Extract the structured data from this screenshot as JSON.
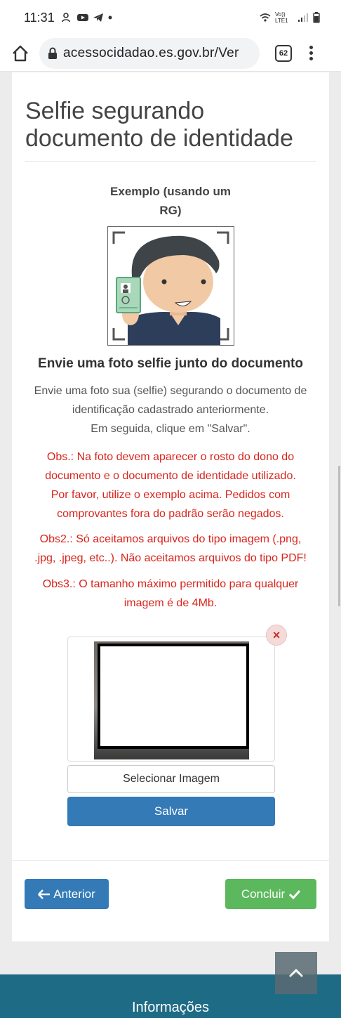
{
  "status_bar": {
    "time": "11:31",
    "network_label": "Vo)) LTE1"
  },
  "browser": {
    "url": "acessocidadao.es.gov.br/Ver",
    "tab_count": "62"
  },
  "page": {
    "title": "Selfie segurando documento de identidade",
    "example_caption_line1": "Exemplo (usando um",
    "example_caption_line2": "RG)",
    "instruction_heading": "Envie uma foto selfie junto do documento",
    "instruction_line1": "Envie uma foto sua (selfie) segurando o documento de",
    "instruction_line2": "identificação cadastrado anteriormente.",
    "instruction_line3": "Em seguida, clique em \"Salvar\".",
    "obs1_line1": "Obs.: Na foto devem aparecer o rosto do dono do",
    "obs1_line2": "documento e o documento de identidade utilizado.",
    "obs1_line3": "Por favor, utilize o exemplo acima. Pedidos com",
    "obs1_line4": "comprovantes fora do padrão serão negados.",
    "obs2_line1": "Obs2.: Só aceitamos arquivos do tipo imagem (.png,",
    "obs2_line2": ".jpg, .jpeg, etc..). Não aceitamos arquivos do tipo PDF!",
    "obs3_line1": "Obs3.: O tamanho máximo permitido para qualquer",
    "obs3_line2": "imagem é de 4Mb.",
    "remove_label": "×",
    "select_image_label": "Selecionar Imagem",
    "save_label": "Salvar",
    "previous_label": "Anterior",
    "finish_label": "Concluir"
  },
  "footer": {
    "title": "Informações"
  },
  "colors": {
    "primary": "#337ab7",
    "success": "#5cb85c",
    "warning_text": "#d9241c",
    "footer": "#1e6b85"
  }
}
